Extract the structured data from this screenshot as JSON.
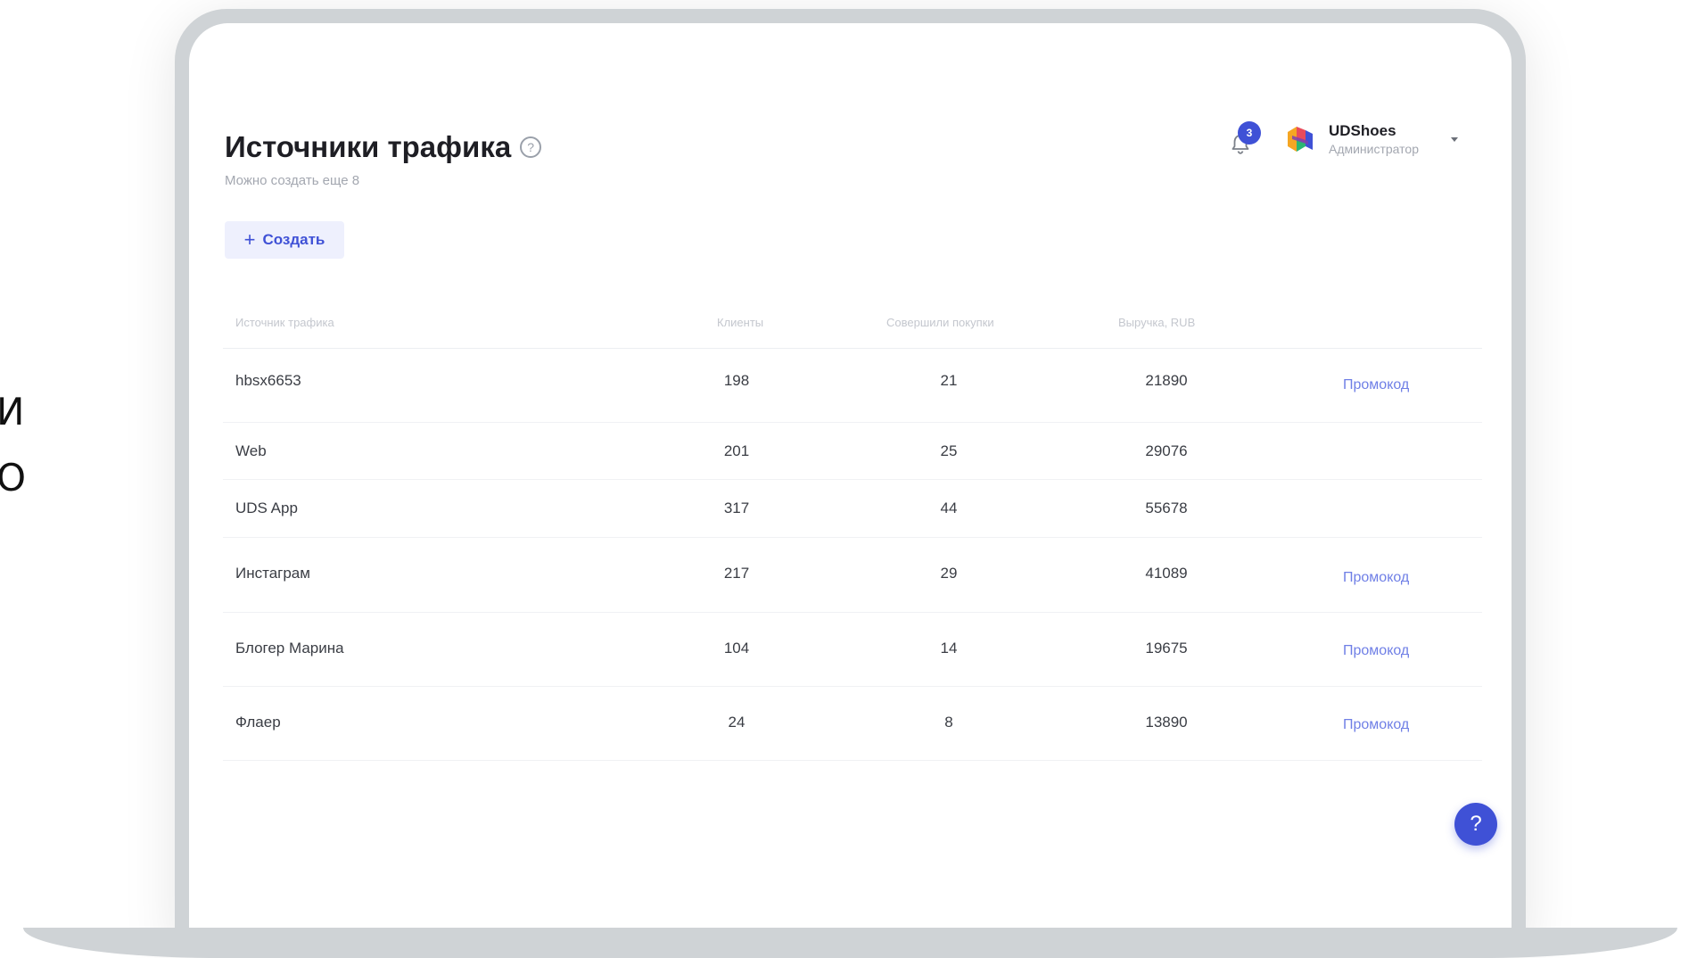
{
  "side_text": [
    "И",
    "О"
  ],
  "page": {
    "title": "Источники трафика",
    "subtitle": "Можно создать еще 8",
    "create_label": "Создать"
  },
  "header": {
    "notification_count": "3",
    "user_name": "UDShoes",
    "user_role": "Администратор"
  },
  "table": {
    "columns": [
      "Источник трафика",
      "Клиенты",
      "Совершили покупки",
      "Выручка, RUB"
    ],
    "rows": [
      {
        "source": "hbsx6653",
        "clients": "198",
        "purchases": "21",
        "revenue": "21890",
        "promo": "Промокод"
      },
      {
        "source": "Web",
        "clients": "201",
        "purchases": "25",
        "revenue": "29076",
        "promo": ""
      },
      {
        "source": "UDS App",
        "clients": "317",
        "purchases": "44",
        "revenue": "55678",
        "promo": ""
      },
      {
        "source": "Инстаграм",
        "clients": "217",
        "purchases": "29",
        "revenue": "41089",
        "promo": "Промокод"
      },
      {
        "source": "Блогер Марина",
        "clients": "104",
        "purchases": "14",
        "revenue": "19675",
        "promo": "Промокод"
      },
      {
        "source": "Флаер",
        "clients": "24",
        "purchases": "8",
        "revenue": "13890",
        "promo": "Промокод"
      }
    ]
  },
  "help_fab_label": "?",
  "colors": {
    "accent": "#3f51d6",
    "promo_link": "#6f7fe6",
    "frame": "#cfd3d6"
  }
}
